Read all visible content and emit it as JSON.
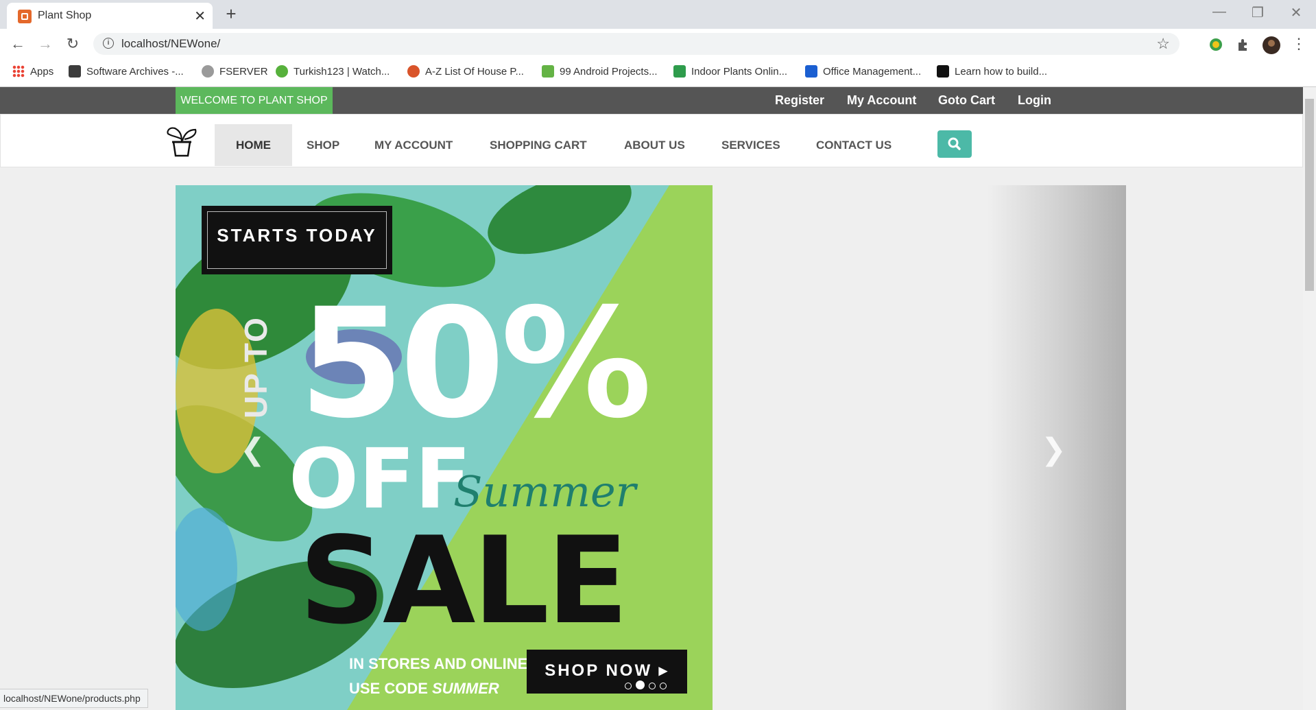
{
  "browser": {
    "tab_title": "Plant Shop",
    "url": "localhost/NEWone/",
    "status_url": "localhost/NEWone/products.php",
    "bookmarks": [
      {
        "label": "Apps",
        "color": "#ea4335"
      },
      {
        "label": "Software Archives -...",
        "color": "#3c3c3c"
      },
      {
        "label": "FSERVER",
        "color": "#9a9a9a"
      },
      {
        "label": "Turkish123 | Watch...",
        "color": "#57b13c"
      },
      {
        "label": "A-Z List Of House P...",
        "color": "#d9542a"
      },
      {
        "label": "99 Android Projects...",
        "color": "#64b345"
      },
      {
        "label": "Indoor Plants Onlin...",
        "color": "#2e9c4c"
      },
      {
        "label": "Office Management...",
        "color": "#1b5fd1"
      },
      {
        "label": "Learn how to build...",
        "color": "#111111"
      }
    ]
  },
  "topbar": {
    "welcome": "WELCOME TO PLANT SHOP",
    "links": [
      "Register",
      "My Account",
      "Goto Cart",
      "Login"
    ]
  },
  "nav": {
    "items": [
      "HOME",
      "SHOP",
      "MY ACCOUNT",
      "SHOPPING CART",
      "ABOUT US",
      "SERVICES",
      "CONTACT US"
    ],
    "active": "HOME"
  },
  "banner": {
    "badge": "STARTS TODAY",
    "upto": "UP TO",
    "percent": "50%",
    "off": "OFF",
    "summer": "Summer",
    "sale": "SALE",
    "line1": "IN STORES AND ONLINE",
    "line2_prefix": "USE CODE ",
    "line2_code": "SUMMER",
    "cta": "SHOP NOW ▸",
    "slide_count": 4,
    "active_slide": 2
  },
  "colors": {
    "topbar": "#555555",
    "welcome": "#5cb85c",
    "search": "#4cb9a7",
    "lime": "#9bd35a"
  }
}
